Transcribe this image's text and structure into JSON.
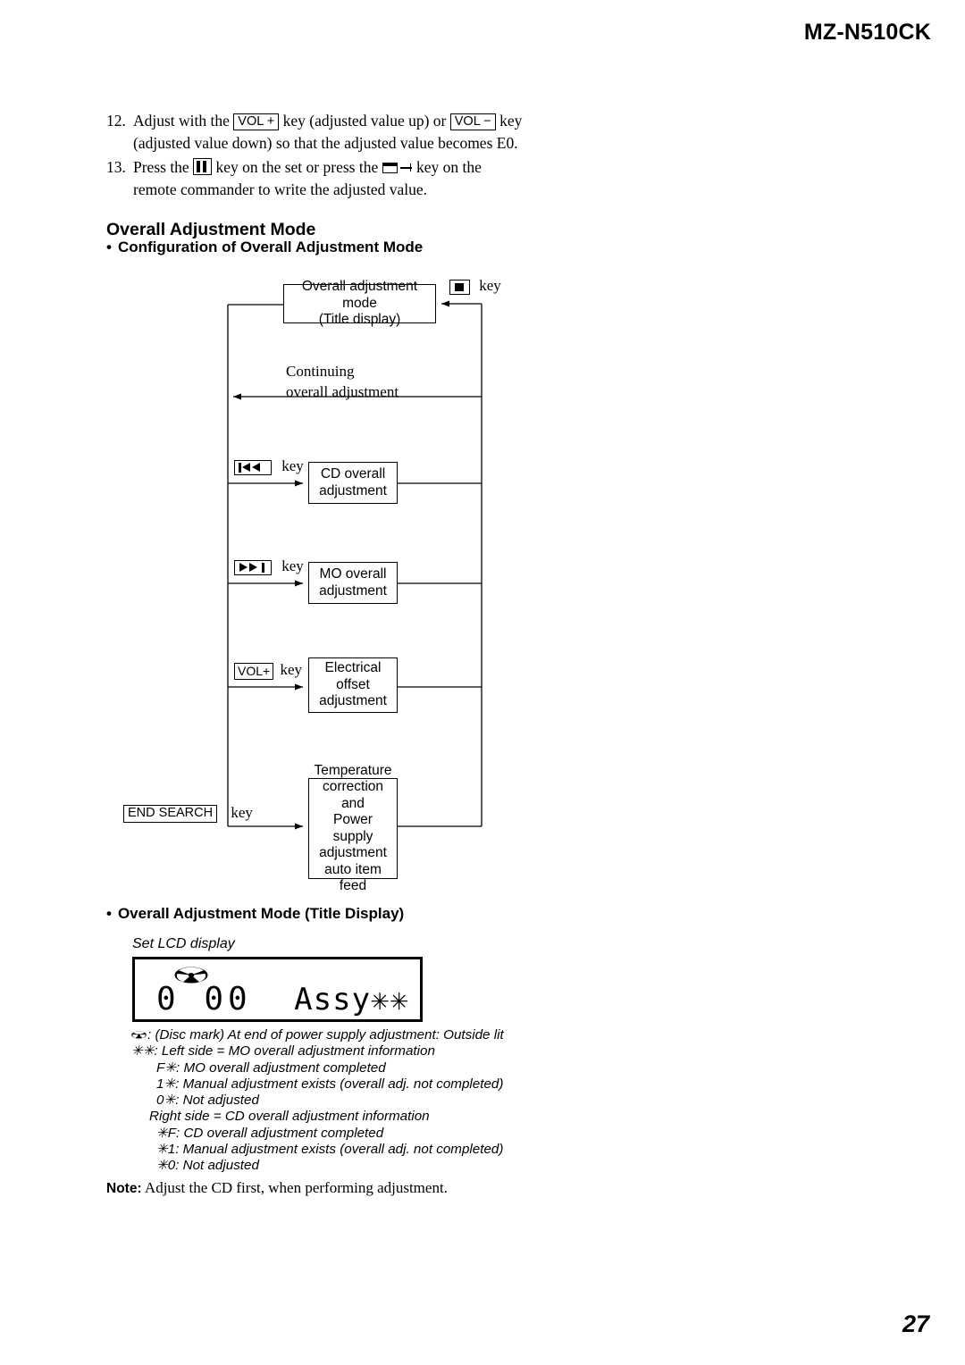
{
  "header": {
    "model": "MZ-N510CK"
  },
  "page_number": "27",
  "steps": [
    {
      "num": "12.",
      "part1": "Adjust with the",
      "key1": "VOL +",
      "part2": "key (adjusted value up) or",
      "key2": "VOL −",
      "part3": "key (adjusted value down) so that the adjusted value becomes E0."
    },
    {
      "num": "13.",
      "part1": "Press the",
      "key1": "pause-key-icon",
      "part2": "key on the set or press the",
      "key2": "display-key-icon",
      "part3": "key on the remote commander to write the adjusted value."
    }
  ],
  "headings": {
    "section": "Overall Adjustment Mode",
    "sub1_bullet": "•",
    "sub1": "Configuration of Overall Adjustment Mode",
    "sub2_bullet": "•",
    "sub2": "Overall Adjustment Mode (Title Display)"
  },
  "flowchart": {
    "stop_key_label": "key",
    "title_box_line1": "Overall adjustment mode",
    "title_box_line2": "(Title display)",
    "continuing_line1": "Continuing",
    "continuing_line2": "overall adjustment",
    "branches": [
      {
        "key_glyph": "prev-track-icon",
        "key_word": "key",
        "box": "CD overall\nadjustment"
      },
      {
        "key_glyph": "next-track-icon",
        "key_word": "key",
        "box": "MO overall\nadjustment"
      },
      {
        "key_glyph": "VOL+",
        "key_word": "key",
        "box": "Electrical\noffset\nadjustment"
      },
      {
        "key_glyph": "END SEARCH",
        "key_word": "key",
        "box": "Temperature\ncorrection\nand\nPower supply\nadjustment\nauto item feed"
      }
    ],
    "box_cd_l1": "CD overall",
    "box_cd_l2": "adjustment",
    "box_mo_l1": "MO overall",
    "box_mo_l2": "adjustment",
    "box_eo_l1": "Electrical",
    "box_eo_l2": "offset",
    "box_eo_l3": "adjustment",
    "box_tp_l1": "Temperature",
    "box_tp_l2": "correction",
    "box_tp_l3": "and",
    "box_tp_l4": "Power supply",
    "box_tp_l5": "adjustment",
    "box_tp_l6": "auto item feed",
    "key_word": "key",
    "vol_plus_label": "VOL+",
    "end_search_label": "END SEARCH"
  },
  "lcd": {
    "caption": "Set LCD display",
    "left_segment": "0 00",
    "right_segment": "Assy✳✳",
    "disc_mark_name": "disc-mark-icon"
  },
  "legend": {
    "rows": [
      {
        "indent": 0,
        "symbol": "disc-mark",
        "text": ": (Disc mark) At end of power supply adjustment: Outside lit"
      },
      {
        "indent": 0,
        "symbol": "✳✳",
        "text": ": Left side = MO overall adjustment information"
      },
      {
        "indent": 1,
        "symbol": "F✳",
        "text": ": MO overall adjustment completed"
      },
      {
        "indent": 1,
        "symbol": "1✳",
        "text": ": Manual adjustment exists (overall adj. not completed)"
      },
      {
        "indent": 1,
        "symbol": "0✳",
        "text": ": Not adjusted"
      },
      {
        "indent": 2,
        "symbol": "",
        "text": "Right side = CD overall adjustment information"
      },
      {
        "indent": 1,
        "symbol": "✳F",
        "text": ": CD overall adjustment completed"
      },
      {
        "indent": 1,
        "symbol": "✳1",
        "text": ": Manual adjustment exists (overall adj. not completed)"
      },
      {
        "indent": 1,
        "symbol": "✳0",
        "text": ": Not adjusted"
      }
    ]
  },
  "note": {
    "label": "Note:",
    "text": " Adjust the CD first, when performing adjustment."
  }
}
